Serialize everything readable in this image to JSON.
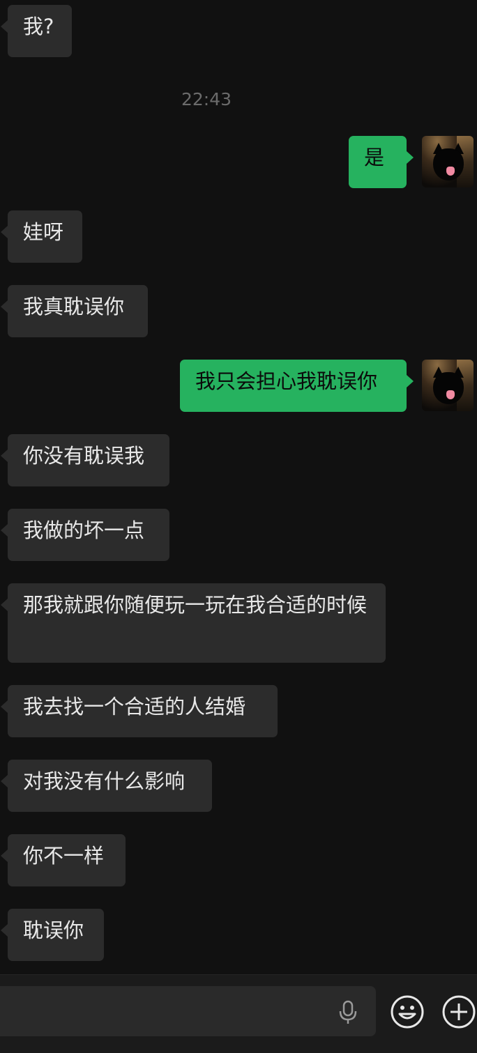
{
  "messages": [
    {
      "text": "我?"
    },
    {
      "text": "是"
    },
    {
      "text": "娃呀"
    },
    {
      "text": "我真耽误你"
    },
    {
      "text": "我只会担心我耽误你"
    },
    {
      "text": "你没有耽误我"
    },
    {
      "text": "我做的坏一点"
    },
    {
      "text": "那我就跟你随便玩一玩在我合适的时候"
    },
    {
      "text": "我去找一个合适的人结婚"
    },
    {
      "text": "对我没有什么影响"
    },
    {
      "text": "你不一样"
    },
    {
      "text": "耽误你"
    }
  ],
  "timestamp": "22:43",
  "input": {
    "value": ""
  },
  "icons": [
    "mic-icon",
    "emoji-icon",
    "plus-icon"
  ],
  "colors": {
    "background": "#111111",
    "incoming_bubble": "#2c2c2c",
    "outgoing_bubble": "#26b25f"
  }
}
